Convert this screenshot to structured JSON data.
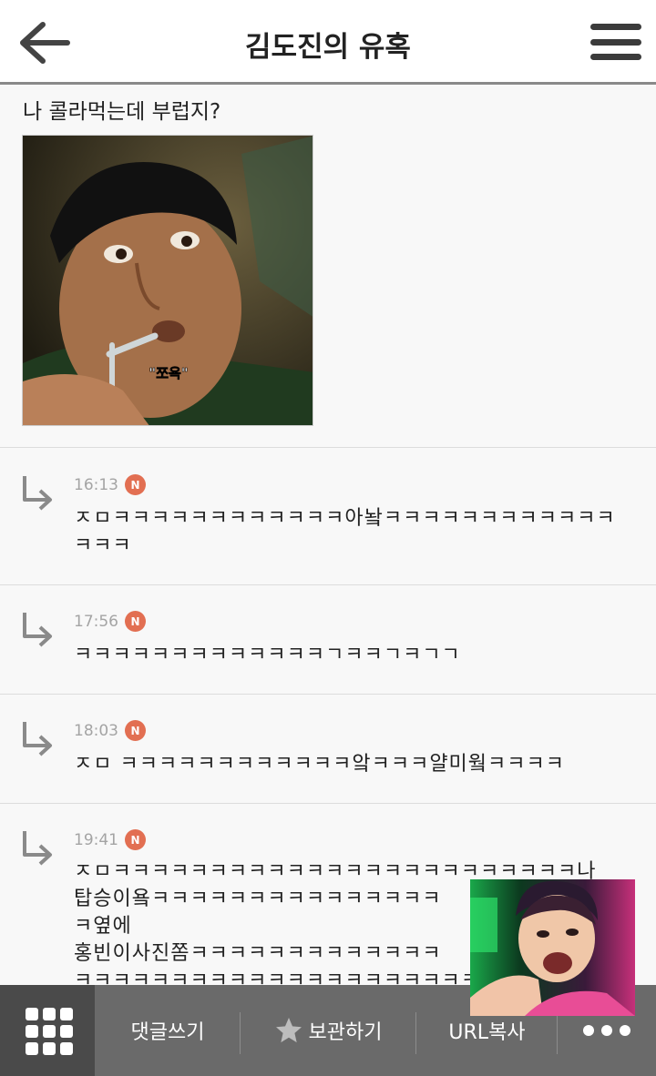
{
  "header": {
    "title": "김도진의 유혹",
    "back_icon": "arrow-left-icon",
    "menu_icon": "hamburger-menu-icon"
  },
  "post": {
    "text": "나 콜라먹는데 부럽지?",
    "image_caption": "\"쪼옥\""
  },
  "comments": [
    {
      "time": "16:13",
      "badge": "N",
      "text": "ㅈㅁㅋㅋㅋㅋㅋㅋㅋㅋㅋㅋㅋㅋ아놬ㅋㅋㅋㅋㅋㅋㅋㅋㅋㅋㅋㅋㅋㅋㅋ"
    },
    {
      "time": "17:56",
      "badge": "N",
      "text": "ㅋㅋㅋㅋㅋㅋㅋㅋㅋㅋㅋㅋㅋㄱㅋㅋㄱㅋㄱㄱ"
    },
    {
      "time": "18:03",
      "badge": "N",
      "text": "ㅈㅁ ㅋㅋㅋㅋㅋㅋㅋㅋㅋㅋㅋㅋ앜ㅋㅋㅋ얄미웤ㅋㅋㅋㅋ"
    },
    {
      "time": "19:41",
      "badge": "N",
      "lines": [
        "ㅈㅁㅋㅋㅋㅋㅋㅋㅋㅋㅋㅋㅋㅋㅋㅋㅋㅋㅋㅋㅋㅋㅋㅋㅋㅋ나",
        "탑승이욬ㅋㅋㅋㅋㅋㅋㅋㅋㅋㅋㅋㅋㅋㅋㅋ",
        "ㅋ옆에",
        "홍빈이사진쫌ㅋㅋㅋㅋㅋㅋㅋㅋㅋㅋㅋㅋㅋ",
        "ㅋㅋㅋㅋㅋㅋㅋㅋㅋㅋㅋㅋㅋㅋㅋㅋㅋㅋㅋㅋㅋㅋ"
      ]
    }
  ],
  "toolbar": {
    "grid_icon": "grid-menu-icon",
    "write_comment": "댓글쓰기",
    "save": "보관하기",
    "save_icon": "star-icon",
    "copy_url": "URL복사",
    "more_icon": "more-dots-icon"
  },
  "colors": {
    "badge": "#e26f52",
    "toolbar": "#6a6a6a",
    "toolbar_dark": "#4a4a4a"
  }
}
